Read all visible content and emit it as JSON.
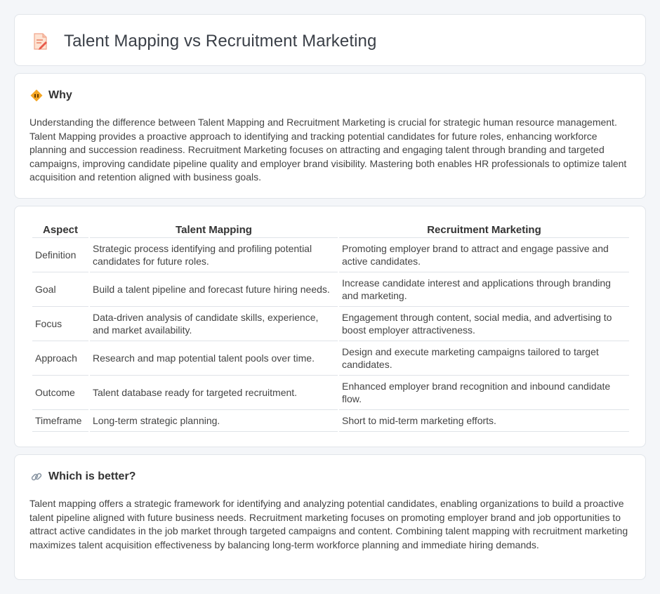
{
  "page": {
    "title": "Talent Mapping vs Recruitment Marketing",
    "title_icon": "document-pencil-icon"
  },
  "why": {
    "icon": "road-sign-icon",
    "heading": "Why",
    "text": "Understanding the difference between Talent Mapping and Recruitment Marketing is crucial for strategic human resource management. Talent Mapping provides a proactive approach to identifying and tracking potential candidates for future roles, enhancing workforce planning and succession readiness. Recruitment Marketing focuses on attracting and engaging talent through branding and targeted campaigns, improving candidate pipeline quality and employer brand visibility. Mastering both enables HR professionals to optimize talent acquisition and retention aligned with business goals."
  },
  "table": {
    "headers": [
      "Aspect",
      "Talent Mapping",
      "Recruitment Marketing"
    ],
    "rows": [
      [
        "Definition",
        "Strategic process identifying and profiling potential candidates for future roles.",
        "Promoting employer brand to attract and engage passive and active candidates."
      ],
      [
        "Goal",
        "Build a talent pipeline and forecast future hiring needs.",
        "Increase candidate interest and applications through branding and marketing."
      ],
      [
        "Focus",
        "Data-driven analysis of candidate skills, experience, and market availability.",
        "Engagement through content, social media, and advertising to boost employer attractiveness."
      ],
      [
        "Approach",
        "Research and map potential talent pools over time.",
        "Design and execute marketing campaigns tailored to target candidates."
      ],
      [
        "Outcome",
        "Talent database ready for targeted recruitment.",
        "Enhanced employer brand recognition and inbound candidate flow."
      ],
      [
        "Timeframe",
        "Long-term strategic planning.",
        "Short to mid-term marketing efforts."
      ]
    ]
  },
  "better": {
    "icon": "link-icon",
    "heading": "Which is better?",
    "text": "Talent mapping offers a strategic framework for identifying and analyzing potential candidates, enabling organizations to build a proactive talent pipeline aligned with future business needs. Recruitment marketing focuses on promoting employer brand and job opportunities to attract active candidates in the job market through targeted campaigns and content. Combining talent mapping with recruitment marketing maximizes talent acquisition effectiveness by balancing long-term workforce planning and immediate hiring demands."
  }
}
